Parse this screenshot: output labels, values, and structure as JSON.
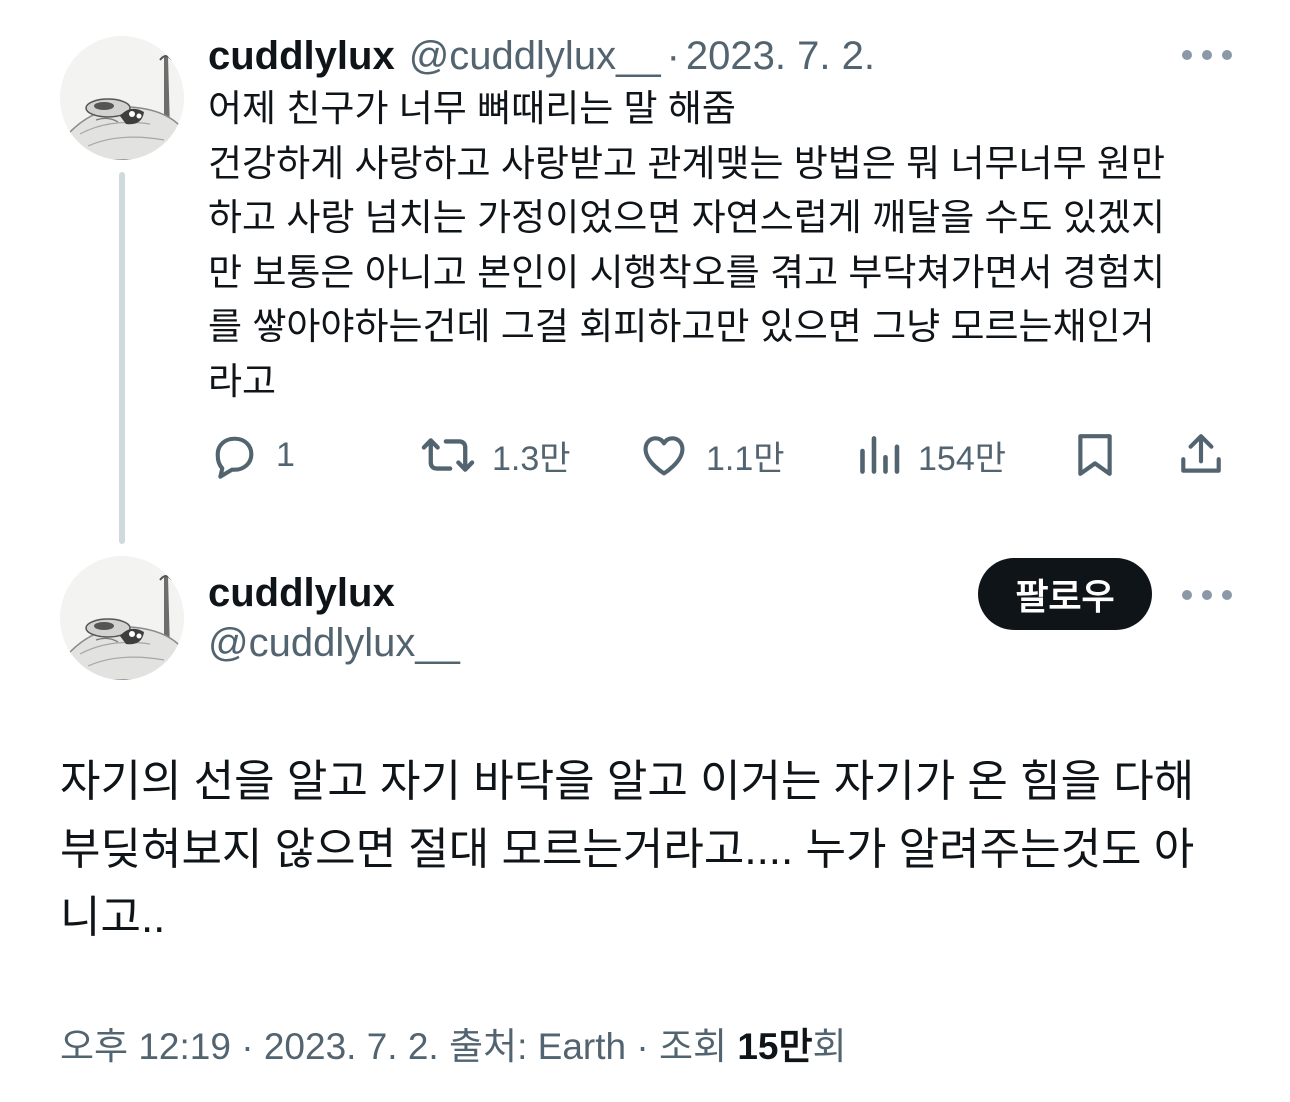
{
  "reply": {
    "author_name": "cuddlylux",
    "author_handle": "@cuddlylux__",
    "separator": "·",
    "date": "2023. 7. 2.",
    "text_lines": [
      "어제 친구가 너무 뼈때리는 말 해줌",
      "건강하게 사랑하고 사랑받고 관계맺는 방법은 뭐 너무너무 원만",
      "하고 사랑 넘치는 가정이었으면 자연스럽게 깨달을 수도 있겠지",
      "만 보통은 아니고 본인이 시행착오를 겪고 부닥쳐가면서 경험치",
      "를 쌓아야하는건데 그걸 회피하고만 있으면 그냥 모르는채인거",
      "라고"
    ],
    "actions": {
      "reply_count": "1",
      "repost_count": "1.3만",
      "like_count": "1.1만",
      "view_count": "154만"
    },
    "icons": [
      "more-icon",
      "reply-icon",
      "repost-icon",
      "like-icon",
      "views-icon",
      "bookmark-icon",
      "share-icon"
    ]
  },
  "main_post": {
    "author_name": "cuddlylux",
    "author_handle": "@cuddlylux__",
    "follow_label": "팔로우",
    "text_lines": [
      "자기의 선을 알고 자기 바닥을 알고 이거는 자기가 온 힘을 다해",
      "부딪혀보지 않으면 절대 모르는거라고.... 누가 알려주는것도 아",
      "니고.."
    ],
    "meta": {
      "time": "오후 12:19",
      "sep1": " · ",
      "date": "2023. 7. 2.",
      "source": " 출처: Earth",
      "sep2": " · ",
      "views_label": "조회 ",
      "views_number": "15만",
      "views_suffix": "회"
    }
  },
  "colors": {
    "text_primary": "#0f1419",
    "text_secondary": "#536471",
    "thread_line": "#cfd9de",
    "follow_button_bg": "#0f1419",
    "follow_button_text": "#ffffff"
  }
}
